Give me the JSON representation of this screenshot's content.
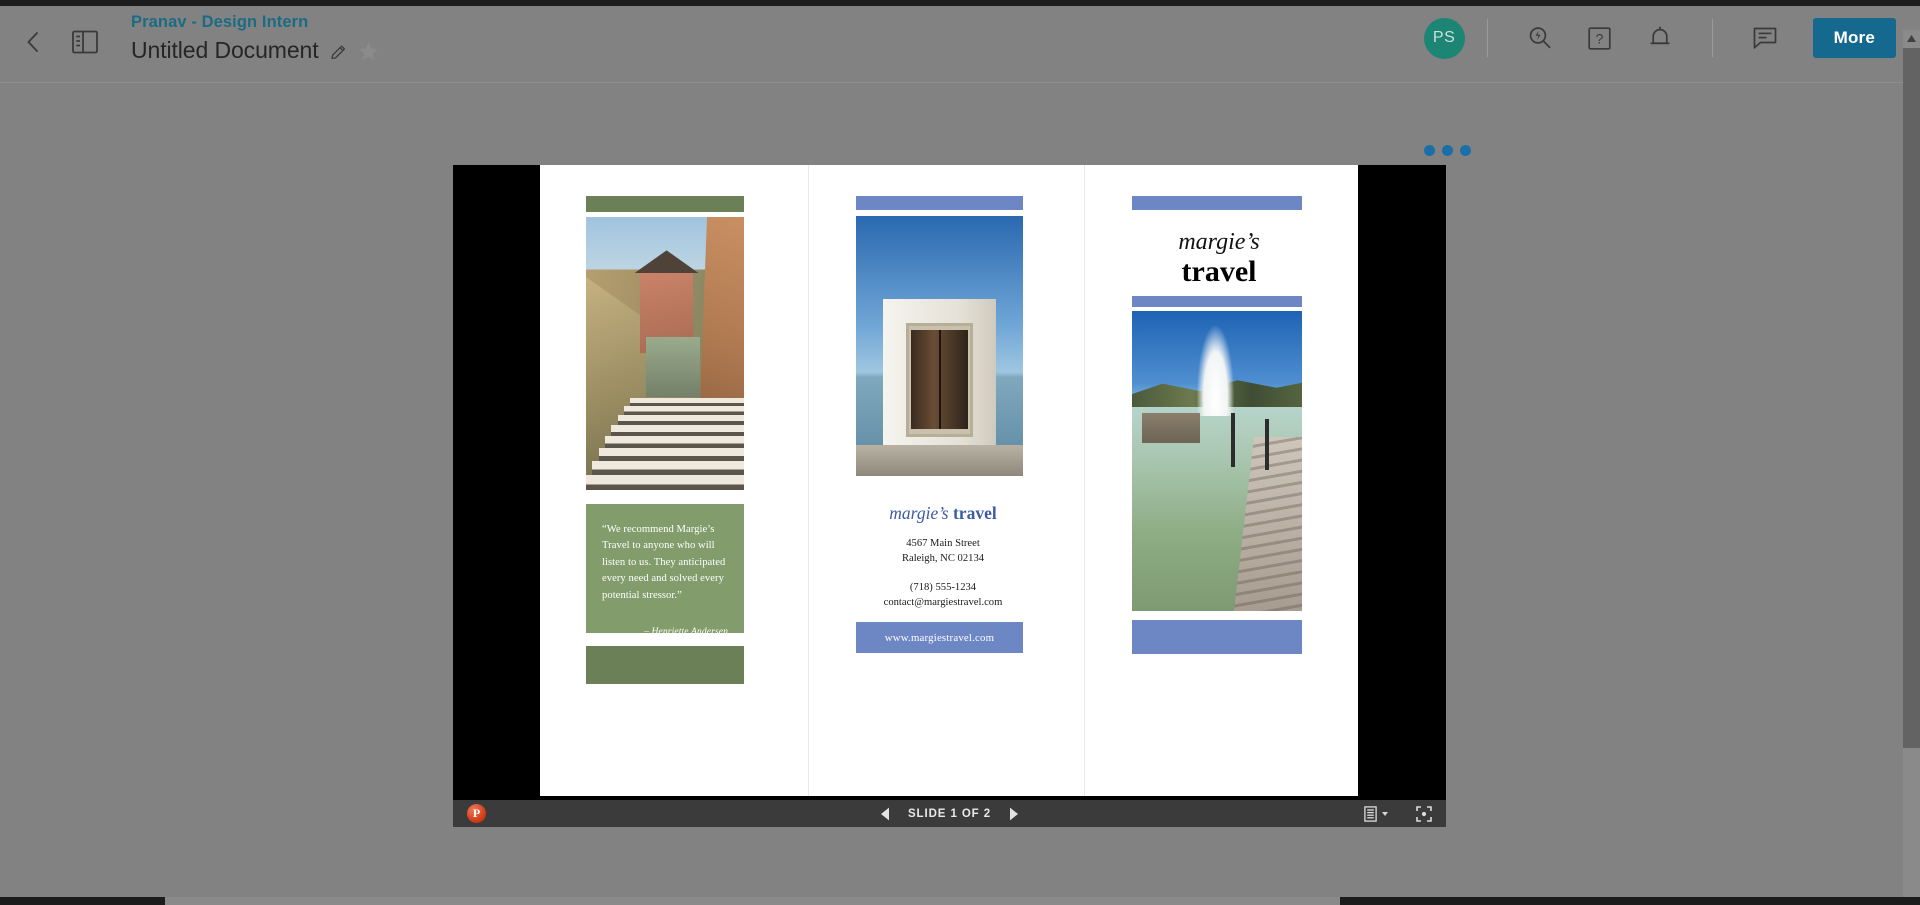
{
  "topbar": {
    "back_icon": "back-chevron-icon",
    "panel_toggle_icon": "sidebar-panel-icon",
    "breadcrumb": "Pranav - Design Intern",
    "doc_title": "Untitled Document",
    "edit_icon": "pencil-icon",
    "favorite_icon": "star-icon",
    "avatar_initials": "PS",
    "avatar_color": "#1d8574",
    "icons": [
      {
        "name": "search-boost-icon",
        "glyph": "search"
      },
      {
        "name": "help-icon",
        "glyph": "question"
      },
      {
        "name": "notifications-bell-icon",
        "glyph": "bell"
      },
      {
        "name": "comments-icon",
        "glyph": "comment"
      }
    ],
    "more_label": "More",
    "more_color": "#15698e"
  },
  "viewer": {
    "loading_indicator": "three-blue-dots",
    "loading_dot_color": "#1b6fa8",
    "stage_background": "#000000"
  },
  "brochure": {
    "green": "#6b8057",
    "green_panel": "#829c6b",
    "blue": "#6d86c4",
    "panel_left": {
      "quote": "“We recommend Margie’s Travel to anyone who will listen to us. They anticipated every need and solved every potential stressor.”",
      "attribution": "– Henriette Andersen",
      "photo_name": "stone-stairs-village-photo"
    },
    "panel_middle": {
      "photo_name": "white-building-door-photo",
      "logo_italic": "margie’s",
      "logo_bold": "travel",
      "address_line1": "4567 Main Street",
      "address_line2": "Raleigh, NC 02134",
      "phone": "(718) 555-1234",
      "email": "contact@margiestravel.com",
      "website": "www.margiestravel.com"
    },
    "panel_right": {
      "logo_italic": "margie’s",
      "logo_bold": "travel",
      "photo_name": "blue-lagoon-pier-photo"
    }
  },
  "bottombar": {
    "app_icon": "powerpoint-icon",
    "app_icon_letter": "P",
    "prev_icon": "previous-slide-icon",
    "next_icon": "next-slide-icon",
    "slide_status": "SLIDE 1 OF 2",
    "view_icon": "view-options-icon",
    "fullscreen_icon": "fullscreen-icon"
  },
  "scrollbar": {
    "up_icon": "scroll-up-arrow-icon"
  }
}
